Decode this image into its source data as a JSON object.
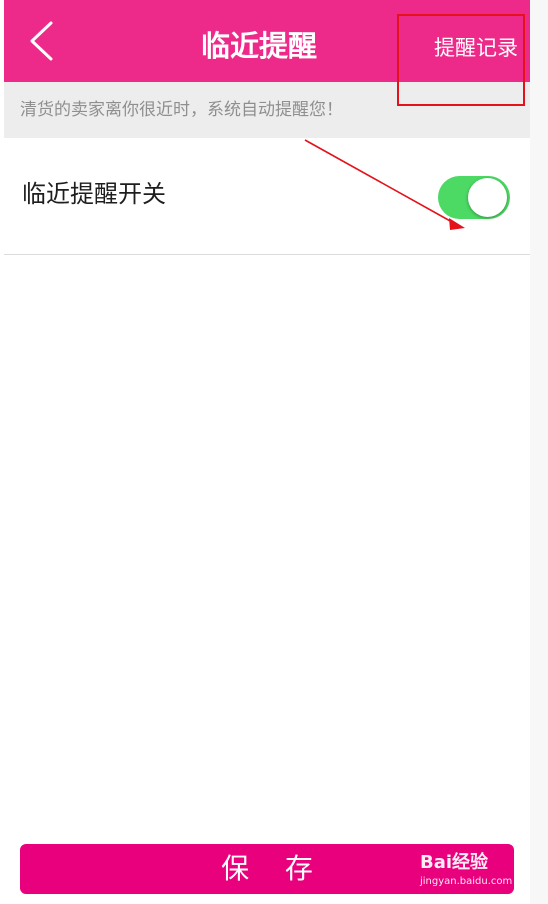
{
  "header": {
    "title": "临近提醒",
    "records_link": "提醒记录",
    "back_icon": "chevron-left-icon",
    "background_color": "#ed2a8a"
  },
  "hint": {
    "text": "清货的卖家离你很近时，系统自动提醒您！"
  },
  "setting": {
    "label": "临近提醒开关",
    "toggle_on": true,
    "toggle_color": "#4cd964"
  },
  "footer": {
    "save_label": "保 存",
    "button_color": "#e8007d"
  },
  "annotation": {
    "color": "#e3121b"
  },
  "watermark": {
    "logo_text": "Bai经验",
    "url": "jingyan.baidu.com"
  }
}
